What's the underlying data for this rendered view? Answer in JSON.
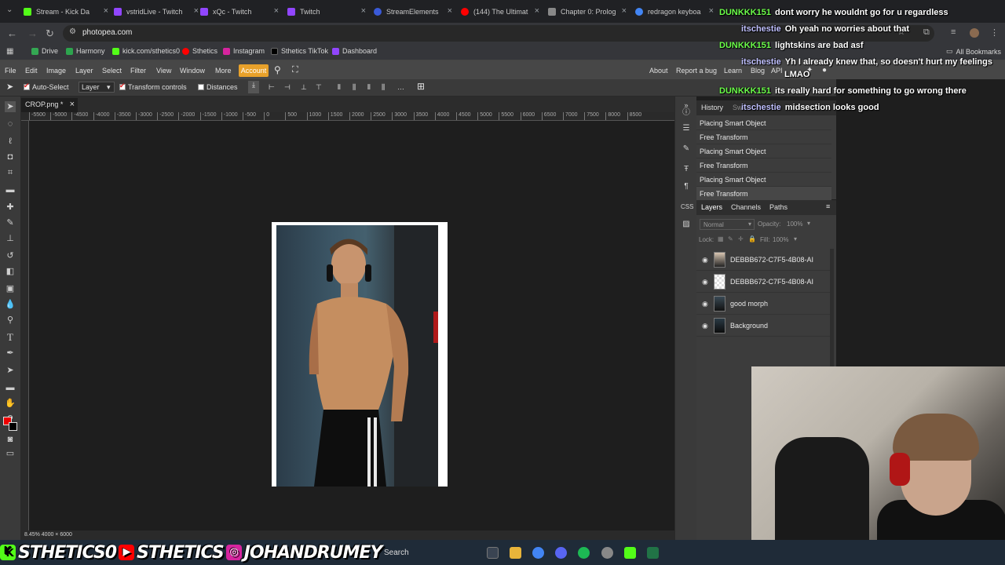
{
  "browser": {
    "tabs": [
      {
        "label": "Stream - Kick Da",
        "color": "#53fc18"
      },
      {
        "label": "vstridLive - Twitch",
        "color": "#9146ff"
      },
      {
        "label": "xQc - Twitch",
        "color": "#9146ff"
      },
      {
        "label": "Twitch",
        "color": "#9146ff"
      },
      {
        "label": "StreamElements",
        "color": "#3a5ad8"
      },
      {
        "label": "(144) The Ultimat",
        "color": "#ff0000"
      },
      {
        "label": "Chapter 0: Prolog",
        "color": "#cccccc"
      },
      {
        "label": "redragon keyboa",
        "color": "#4285f4"
      }
    ],
    "url": "photopea.com",
    "bookmarks": [
      {
        "label": "Drive",
        "color": "#34a853"
      },
      {
        "label": "Harmony",
        "color": "#2da44e"
      },
      {
        "label": "kick.com/sthetics0",
        "color": "#53fc18"
      },
      {
        "label": "Sthetics",
        "color": "#ff0000"
      },
      {
        "label": "Instagram",
        "color": "#d6249f"
      },
      {
        "label": "Sthetics TikTok",
        "color": "#000000"
      },
      {
        "label": "Dashboard",
        "color": "#9146ff"
      }
    ],
    "all_bookmarks": "All Bookmarks"
  },
  "photopea": {
    "menu": [
      "File",
      "Edit",
      "Image",
      "Layer",
      "Select",
      "Filter",
      "View",
      "Window",
      "More"
    ],
    "account": "Account",
    "right_menu": [
      "About",
      "Report a bug",
      "Learn",
      "Blog",
      "API"
    ],
    "options": {
      "auto_select": "Auto-Select",
      "layer_dropdown": "Layer",
      "transform_controls": "Transform controls",
      "distances": "Distances"
    },
    "doc_tab": "CROP.png *",
    "ruler_ticks": [
      "-5500",
      "-5000",
      "-4500",
      "-4000",
      "-3500",
      "-3000",
      "-2500",
      "-2000",
      "-1500",
      "-1000",
      "-500",
      "0",
      "500",
      "1000",
      "1500",
      "2000",
      "2500",
      "3000",
      "3500",
      "4000",
      "4500",
      "5000",
      "5500",
      "6000",
      "6500",
      "7000",
      "7500",
      "8000",
      "8500"
    ],
    "status": "8.45%   4000 × 6000",
    "history": {
      "tab": "History",
      "tab2": "Sw",
      "items": [
        "Placing Smart Object",
        "Free Transform",
        "Placing Smart Object",
        "Free Transform",
        "Placing Smart Object",
        "Free Transform"
      ]
    },
    "layers_panel": {
      "tabs": [
        "Layers",
        "Channels",
        "Paths"
      ],
      "blend_mode": "Normal",
      "opacity_label": "Opacity:",
      "opacity_value": "100%",
      "lock_label": "Lock:",
      "fill_label": "Fill:",
      "fill_value": "100%",
      "layers": [
        "DEBBB672-C7F5-4B08-AI",
        "DEBBB672-C7F5-4B08-AI",
        "good morph",
        "Background"
      ]
    }
  },
  "chat": [
    {
      "user": "DUNKKK151",
      "color": "#6cff4a",
      "msg": "dont worry he wouldnt go for u regardless"
    },
    {
      "user": "itschestie",
      "color": "#c0c0ff",
      "msg": "Oh yeah no worries about that"
    },
    {
      "user": "DUNKKK151",
      "color": "#6cff4a",
      "msg": "lightskins are bad asf"
    },
    {
      "user": "itschestie",
      "color": "#c0c0ff",
      "msg": "Yh I already knew that, so doesn't hurt my feelings"
    },
    {
      "user": "",
      "color": "#ffffff",
      "msg": "LMAO"
    },
    {
      "user": "DUNKKK151",
      "color": "#6cff4a",
      "msg": "its really hard for something to go wrong there"
    },
    {
      "user": "itschestie",
      "color": "#c0c0ff",
      "msg": "midsection looks good"
    }
  ],
  "taskbar": {
    "socials": [
      "STHETICS0",
      "STHETICS",
      "JOHANDRUMEY"
    ],
    "search": "Search"
  }
}
